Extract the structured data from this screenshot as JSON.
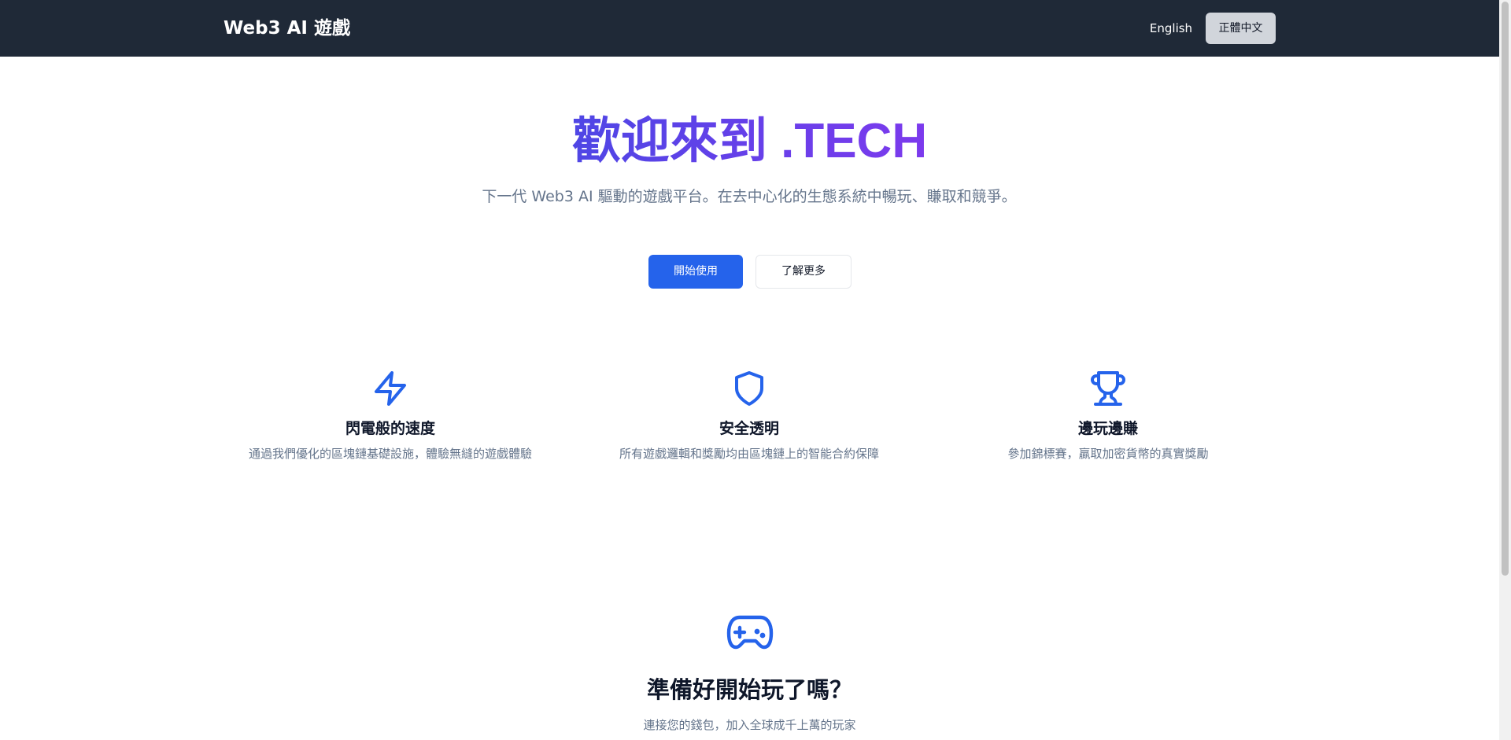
{
  "header": {
    "brand": "Web3 AI 遊戲",
    "lang_english": "English",
    "lang_chinese": "正體中文"
  },
  "hero": {
    "title": "歡迎來到 .TECH",
    "subtitle": "下一代 Web3 AI 驅動的遊戲平台。在去中心化的生態系統中暢玩、賺取和競爭。",
    "primary_button": "開始使用",
    "secondary_button": "了解更多"
  },
  "features": [
    {
      "icon": "lightning-icon",
      "title": "閃電般的速度",
      "description": "通過我們優化的區塊鏈基礎設施，體驗無縫的遊戲體驗"
    },
    {
      "icon": "shield-icon",
      "title": "安全透明",
      "description": "所有遊戲邏輯和獎勵均由區塊鏈上的智能合約保障"
    },
    {
      "icon": "trophy-icon",
      "title": "邊玩邊賺",
      "description": "參加錦標賽，贏取加密貨幣的真實獎勵"
    }
  ],
  "cta": {
    "icon": "gamepad-icon",
    "title": "準備好開始玩了嗎？",
    "description": "連接您的錢包，加入全球成千上萬的玩家"
  },
  "colors": {
    "header_bg": "#1f2937",
    "primary": "#2563eb",
    "title_gradient_start": "#4f46e5",
    "title_gradient_end": "#7c3aed",
    "muted_text": "#64748b"
  }
}
